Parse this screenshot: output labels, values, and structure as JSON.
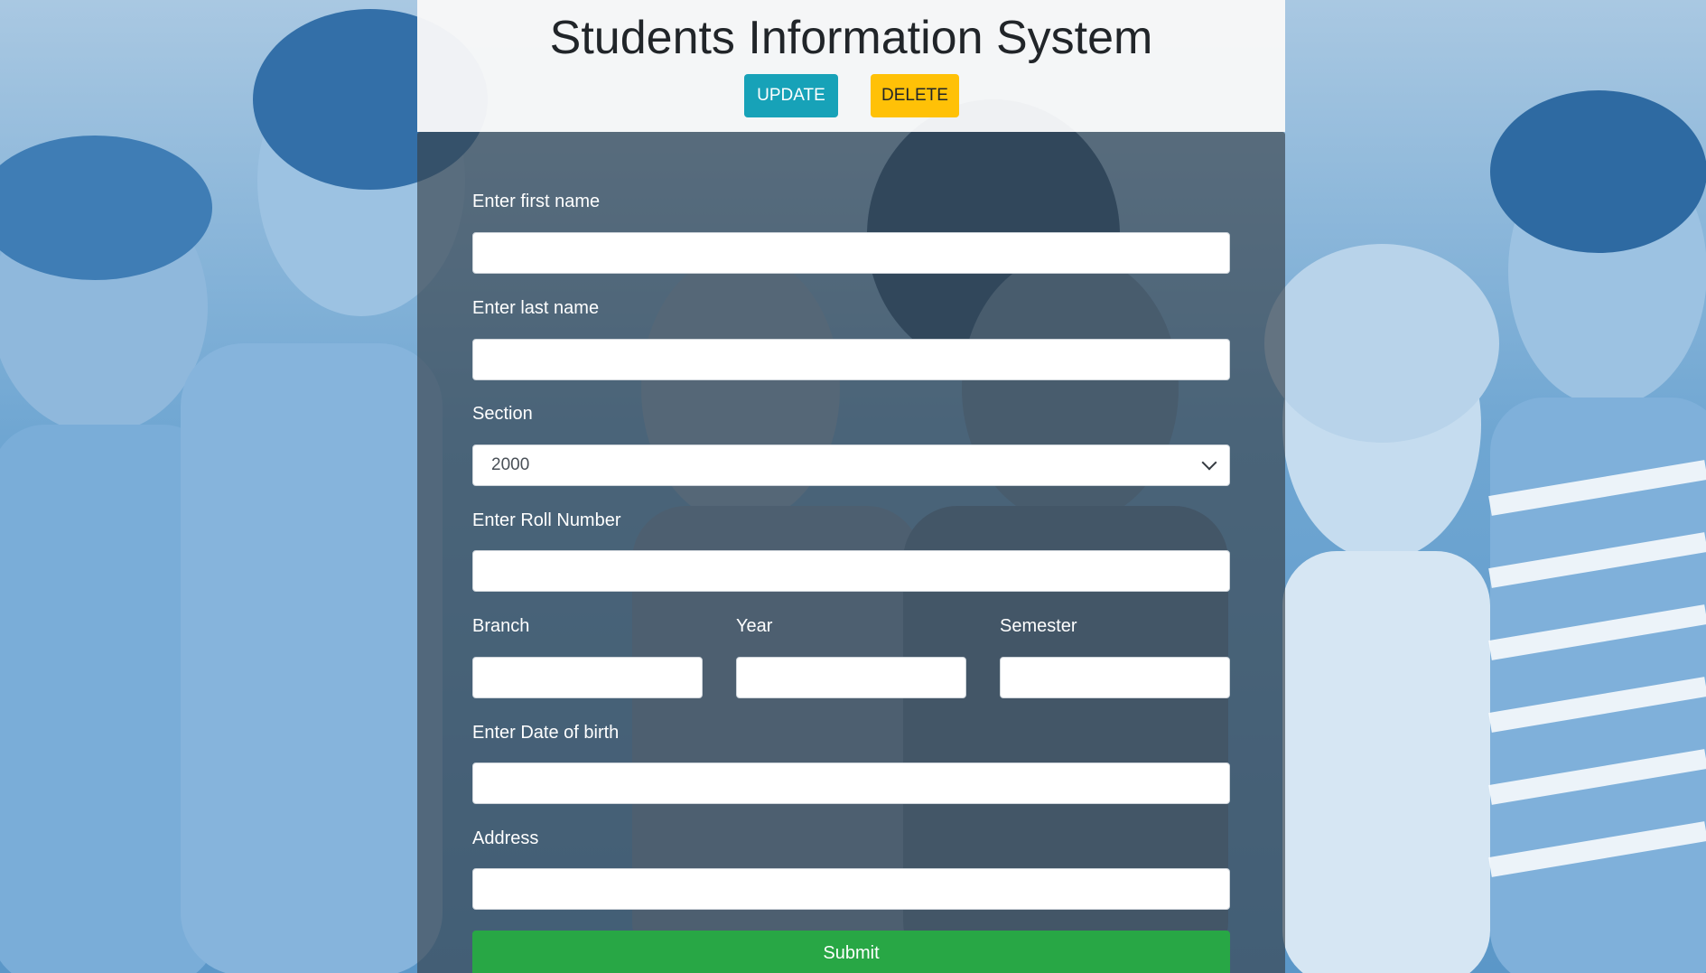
{
  "header": {
    "title": "Students Information System",
    "update_label": "UPDATE",
    "delete_label": "DELETE"
  },
  "form": {
    "first_name": {
      "label": "Enter first name",
      "value": ""
    },
    "last_name": {
      "label": "Enter last name",
      "value": ""
    },
    "section": {
      "label": "Section",
      "selected": "2000"
    },
    "roll_number": {
      "label": "Enter Roll Number",
      "value": ""
    },
    "branch": {
      "label": "Branch",
      "value": ""
    },
    "year": {
      "label": "Year",
      "value": ""
    },
    "semester": {
      "label": "Semester",
      "value": ""
    },
    "dob": {
      "label": "Enter Date of birth",
      "value": ""
    },
    "address": {
      "label": "Address",
      "value": ""
    },
    "submit_label": "Submit"
  },
  "colors": {
    "update_button": "#17a2b8",
    "delete_button": "#ffc107",
    "submit_button": "#28a745",
    "background_tint": "#5b97c8"
  }
}
